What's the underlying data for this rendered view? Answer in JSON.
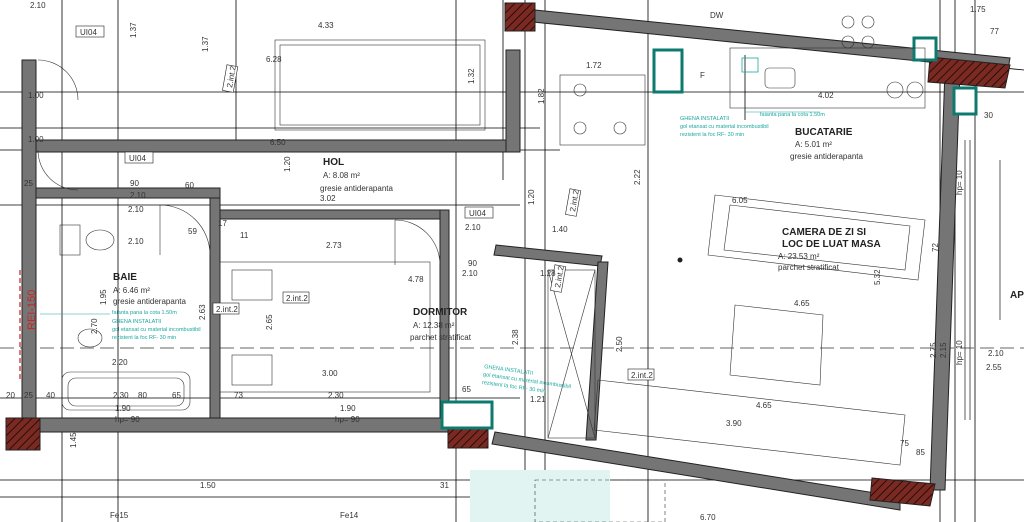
{
  "rooms": {
    "hol": {
      "name": "HOL",
      "area": "A: 8.08 m²",
      "finish": "gresie antiderapanta"
    },
    "baie": {
      "name": "BAIE",
      "area": "A: 6.46 m²",
      "finish": "gresie antiderapanta"
    },
    "dormitor": {
      "name": "DORMITOR",
      "area": "A: 12.38 m²",
      "finish": "parchet stratificat"
    },
    "bucatarie": {
      "name": "BUCATARIE",
      "area": "A: 5.01 m²",
      "finish": "gresie antiderapanta"
    },
    "camera": {
      "name_line1": "CAMERA DE ZI SI",
      "name_line2": "LOC DE LUAT MASA",
      "area": "A: 23.53 m²",
      "finish": "parchet stratificat"
    }
  },
  "tags": {
    "int2": "2.int.2",
    "ui04": "UI04",
    "fe15": "Fe15",
    "fe14": "Fe14",
    "dw": "DW",
    "f": "F",
    "rei": "REI-150",
    "ap": "AP",
    "hp90": "hp= 90",
    "hp10": "hp= 10"
  },
  "dims": {
    "d433": "4.33",
    "d628": "6.28",
    "d137a": "1.37",
    "d137b": "1.37",
    "d132": "1.32",
    "d650": "6.50",
    "d120a": "1.20",
    "d182": "1.82",
    "d172": "1.72",
    "d402": "4.02",
    "d605": "6.05",
    "d140": "1.40",
    "d128": "1.28",
    "d273": "2.73",
    "d478": "4.78",
    "d302": "3.02",
    "d210a": "2.10",
    "d210b": "2.10",
    "d210c": "2.10",
    "d210d": "2.10",
    "d210e": "2.10",
    "d210f": "2.10",
    "d90a": "90",
    "d90b": "90",
    "d60": "60",
    "d59": "59",
    "d17": "17",
    "d11": "11",
    "d195": "1.95",
    "d270": "2.70",
    "d220": "2.20",
    "d265": "2.65",
    "d263": "2.63",
    "d300": "3.00",
    "d238": "2.38",
    "d250": "2.50",
    "d121": "1.21",
    "d465a": "4.65",
    "d465b": "4.65",
    "d390": "3.90",
    "d230a": "2.30",
    "d230b": "2.30",
    "d190a": "1.90",
    "d190b": "1.90",
    "d20": "20",
    "d25a": "25",
    "d25b": "25",
    "d40": "40",
    "d80": "80",
    "d65a": "65",
    "d65b": "65",
    "d73": "73",
    "d150": "1.50",
    "d670": "6.70",
    "d31": "31",
    "d222": "2.22",
    "d120b": "1.20",
    "d532": "5.32",
    "d255": "2.55",
    "d100a": "1.00",
    "d100b": "1.00",
    "d30": "30",
    "d75": "75",
    "d77": "77",
    "d175": "1.75",
    "d72": "72",
    "d85": "85",
    "d275": "2.75",
    "d215": "2.15",
    "d145": "1.45"
  },
  "notes": {
    "n1a": "GHENA INSTALATII",
    "n1b": "gol etansat cu material incombustibil",
    "n1c": "rezistent la foc  RF- 30 min",
    "n2a": "GHENA INSTALATII",
    "n2b": "gol etansat cu material incombustibil",
    "n2c": "rezistent la foc  RF- 30 min",
    "n3a": "GHENA INSTALATII",
    "n3b": "gol etansat cu material incombustibil",
    "n3c": "rezistent la foc  RF- 30 min",
    "n4": "faianta pana la cota 1.50m",
    "n5": "faianta pana la cota 1.50m"
  }
}
